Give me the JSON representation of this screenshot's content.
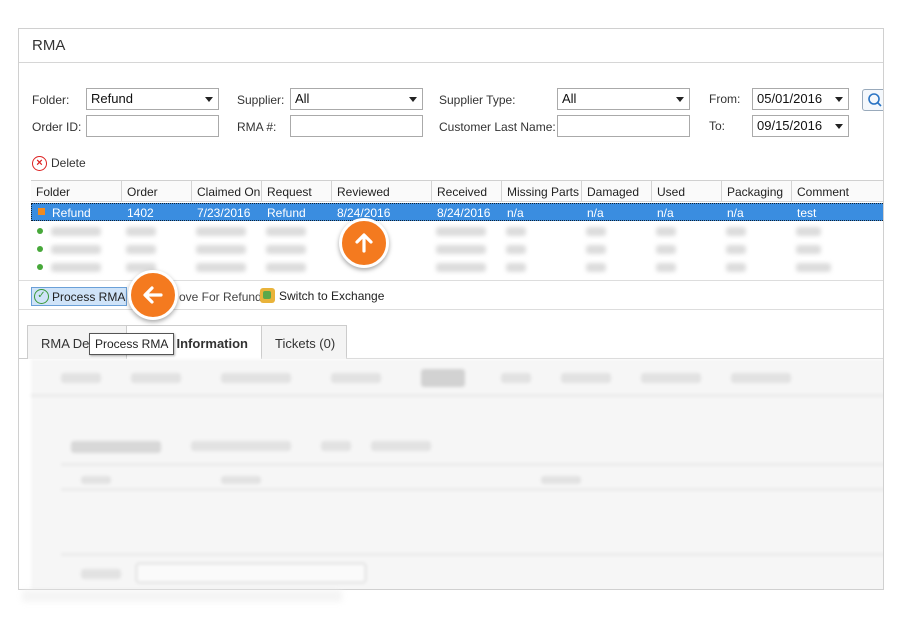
{
  "window": {
    "title": "RMA"
  },
  "filters": {
    "folder_label": "Folder:",
    "folder_value": "Refund",
    "supplier_label": "Supplier:",
    "supplier_value": "All",
    "supplier_type_label": "Supplier Type:",
    "supplier_type_value": "All",
    "from_label": "From:",
    "from_value": "05/01/2016",
    "order_id_label": "Order ID:",
    "order_id_value": "",
    "rma_label": "RMA #:",
    "rma_value": "",
    "customer_last_name_label": "Customer Last Name:",
    "customer_last_name_value": "",
    "to_label": "To:",
    "to_value": "09/15/2016",
    "search_icon": "search-icon"
  },
  "toolbar": {
    "delete_label": "Delete"
  },
  "grid": {
    "columns": [
      "Folder",
      "Order",
      "Claimed On",
      "Request",
      "Reviewed",
      "Received",
      "Missing Parts",
      "Damaged",
      "Used",
      "Packaging",
      "Comment"
    ],
    "selected_row": [
      "Refund",
      "1402",
      "7/23/2016",
      "Refund",
      "8/24/2016",
      "8/24/2016",
      "n/a",
      "n/a",
      "n/a",
      "n/a",
      "test"
    ]
  },
  "actions": {
    "process_label": "Process RMA",
    "approve_label": "ove For Refund",
    "exchange_label": "Switch to Exchange"
  },
  "tabs": [
    {
      "label": "RMA De"
    },
    {
      "label": "r Information"
    },
    {
      "label": "Tickets (0)"
    }
  ],
  "tooltip": {
    "text": "Process RMA"
  },
  "colors": {
    "accent": "#f47a1f",
    "selection": "#3a8de0",
    "delete": "#d22222"
  }
}
